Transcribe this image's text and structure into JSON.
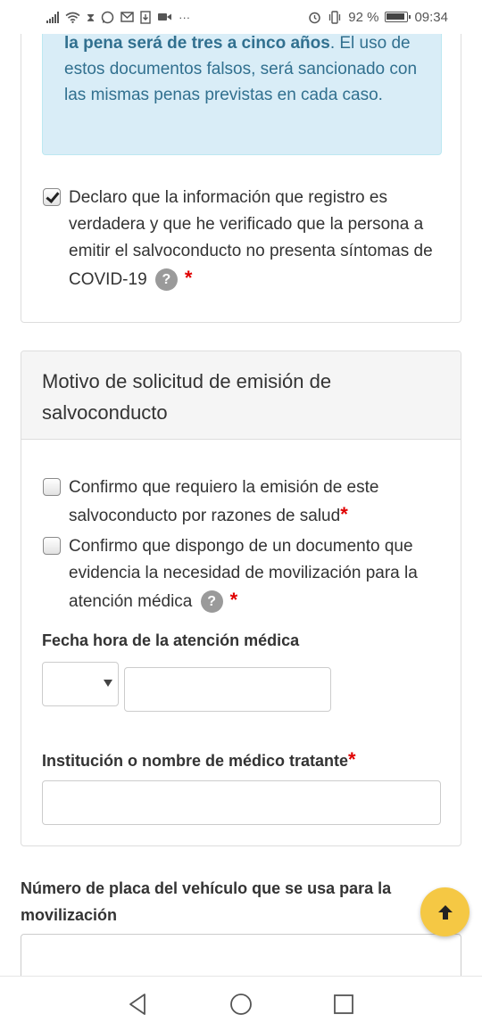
{
  "status_bar": {
    "battery_text": "92 %",
    "time": "09:34",
    "more_indicator": "···",
    "icons": [
      "signal-icon",
      "wifi-icon",
      "hourglass-icon",
      "whatsapp-icon",
      "gmail-icon",
      "download-icon",
      "video-icon",
      "alarm-icon",
      "vibrate-icon",
      "battery-icon"
    ]
  },
  "alert": {
    "bold_text": "la pena será de tres a cinco años",
    "text_tail": ". El uso de estos documentos falsos, será sancionado con las mismas penas previstas en cada caso."
  },
  "declaration": {
    "label": "Declaro que la información que registro es verdadera y que he verificado que la persona a emitir el salvoconducto no presenta síntomas de COVID-19",
    "checked": true,
    "help_glyph": "?",
    "required_mark": "*"
  },
  "motivo_section": {
    "title": "Motivo de solicitud de emisión de salvoconducto",
    "checkbox_salud": {
      "label": "Confirmo que requiero la emisión de este salvoconducto por razones de salud",
      "required_mark": "*",
      "checked": false
    },
    "checkbox_documento": {
      "label": "Confirmo que dispongo de un documento que evidencia la necesidad de movilización para la atención médica",
      "help_glyph": "?",
      "required_mark": "*",
      "checked": false
    },
    "fecha_label": "Fecha hora de la atención médica",
    "fecha_select_value": "",
    "fecha_input_value": "",
    "institucion_label": "Institución o nombre de médico tratante",
    "institucion_required_mark": "*",
    "institucion_value": ""
  },
  "placa": {
    "label": "Número de placa del vehículo que se usa para la movilización",
    "value": ""
  },
  "colors": {
    "alert_bg": "#d9edf7",
    "alert_text": "#31708f",
    "required": "#e00000",
    "fab": "#f5c844"
  }
}
